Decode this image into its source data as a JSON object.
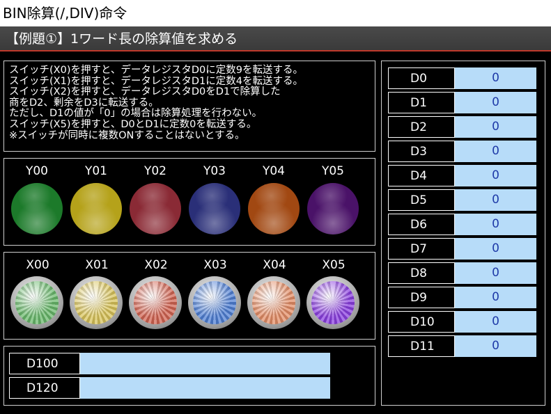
{
  "window": {
    "title": "BIN除算(/,DIV)命令"
  },
  "header": {
    "title": "【例題①】1ワード長の除算値を求める"
  },
  "description": {
    "lines": [
      "スイッチ(X0)を押すと、データレジスタD0に定数9を転送する。",
      "スイッチ(X1)を押すと、データレジスタD1に定数4を転送する。",
      "スイッチ(X2)を押すと、データレジスタD0をD1で除算した",
      "商をD2、剰余をD3に転送する。",
      "ただし、D1の値が「0」の場合は除算処理を行わない。",
      "スイッチ(X5)を押すと、D0とD1に定数0を転送する。",
      "※スイッチが同時に複数ONすることはないとする。"
    ]
  },
  "lamps": [
    {
      "label": "Y00",
      "color": "#1c7a2a"
    },
    {
      "label": "Y01",
      "color": "#b5a21a"
    },
    {
      "label": "Y02",
      "color": "#8a2a35"
    },
    {
      "label": "Y03",
      "color": "#2a2f78"
    },
    {
      "label": "Y04",
      "color": "#a14812"
    },
    {
      "label": "Y05",
      "color": "#4a1268"
    }
  ],
  "switches": [
    {
      "label": "X00",
      "color": "#69b86b"
    },
    {
      "label": "X01",
      "color": "#d8c35a"
    },
    {
      "label": "X02",
      "color": "#d26452"
    },
    {
      "label": "X03",
      "color": "#4f7fd4"
    },
    {
      "label": "X04",
      "color": "#e38d66"
    },
    {
      "label": "X05",
      "color": "#8b3fe0"
    }
  ],
  "bottom_registers": [
    {
      "name": "D100",
      "value": ""
    },
    {
      "name": "D120",
      "value": ""
    }
  ],
  "right_registers": [
    {
      "name": "D0",
      "value": "0"
    },
    {
      "name": "D1",
      "value": "0"
    },
    {
      "name": "D2",
      "value": "0"
    },
    {
      "name": "D3",
      "value": "0"
    },
    {
      "name": "D4",
      "value": "0"
    },
    {
      "name": "D5",
      "value": "0"
    },
    {
      "name": "D6",
      "value": "0"
    },
    {
      "name": "D7",
      "value": "0"
    },
    {
      "name": "D8",
      "value": "0"
    },
    {
      "name": "D9",
      "value": "0"
    },
    {
      "name": "D10",
      "value": "0"
    },
    {
      "name": "D11",
      "value": "0"
    }
  ]
}
